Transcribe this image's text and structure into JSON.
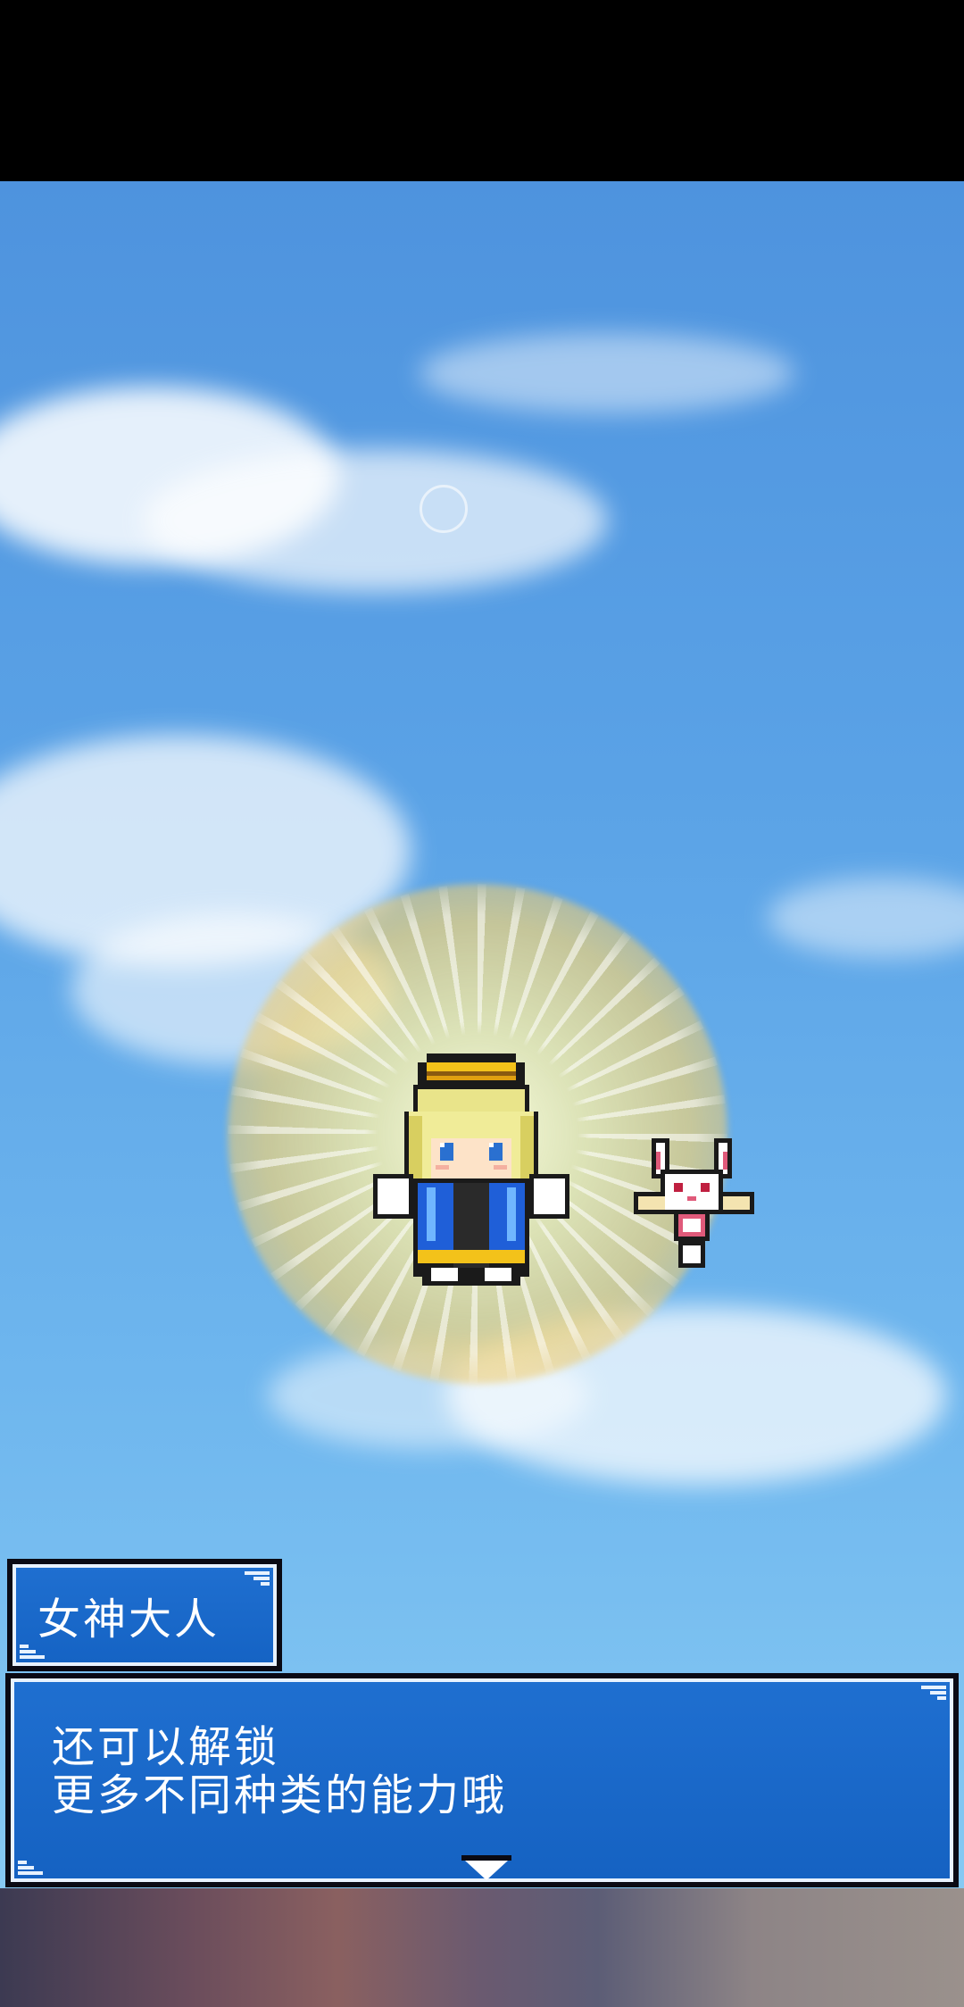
{
  "scene": {
    "sky_color": "#5aa2e6",
    "glow_color": "#f0d27a"
  },
  "dialog": {
    "speaker": "女神大人",
    "line1": "还可以解锁",
    "line2": "更多不同种类的能力哦",
    "box_color": "#1563c4",
    "border_color": "#e8f2ff"
  },
  "icons": {
    "advance": "down-triangle-icon"
  }
}
